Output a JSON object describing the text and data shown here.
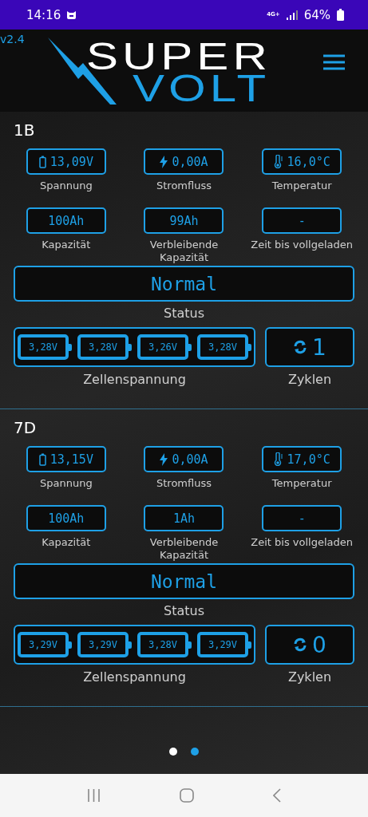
{
  "status_bar": {
    "time": "14:16",
    "network": "4G+",
    "battery": "64%"
  },
  "header": {
    "version": "v2.4",
    "logo_top": "SUPER",
    "logo_bottom": "VOLT"
  },
  "batteries": [
    {
      "name": "1B",
      "metrics": [
        {
          "kind": "voltage",
          "value": "13,09V",
          "label": "Spannung"
        },
        {
          "kind": "current",
          "value": "0,00A",
          "label": "Stromfluss"
        },
        {
          "kind": "temperature",
          "value": "16,0°C",
          "label": "Temperatur"
        },
        {
          "kind": "plain",
          "value": "100Ah",
          "label": "Kapazität"
        },
        {
          "kind": "plain",
          "value": "99Ah",
          "label": "Verbleibende Kapazität"
        },
        {
          "kind": "plain",
          "value": "-",
          "label": "Zeit bis vollgeladen"
        }
      ],
      "status": {
        "value": "Normal",
        "label": "Status"
      },
      "cells": {
        "values": [
          "3,28V",
          "3,28V",
          "3,26V",
          "3,28V"
        ],
        "label": "Zellenspannung"
      },
      "cycles": {
        "value": "1",
        "label": "Zyklen"
      }
    },
    {
      "name": "7D",
      "metrics": [
        {
          "kind": "voltage",
          "value": "13,15V",
          "label": "Spannung"
        },
        {
          "kind": "current",
          "value": "0,00A",
          "label": "Stromfluss"
        },
        {
          "kind": "temperature",
          "value": "17,0°C",
          "label": "Temperatur"
        },
        {
          "kind": "plain",
          "value": "100Ah",
          "label": "Kapazität"
        },
        {
          "kind": "plain",
          "value": "1Ah",
          "label": "Verbleibende Kapazität"
        },
        {
          "kind": "plain",
          "value": "-",
          "label": "Zeit bis vollgeladen"
        }
      ],
      "status": {
        "value": "Normal",
        "label": "Status"
      },
      "cells": {
        "values": [
          "3,29V",
          "3,29V",
          "3,28V",
          "3,29V"
        ],
        "label": "Zellenspannung"
      },
      "cycles": {
        "value": "0",
        "label": "Zyklen"
      }
    }
  ],
  "pager": [
    {
      "selected": false
    },
    {
      "selected": true
    }
  ]
}
